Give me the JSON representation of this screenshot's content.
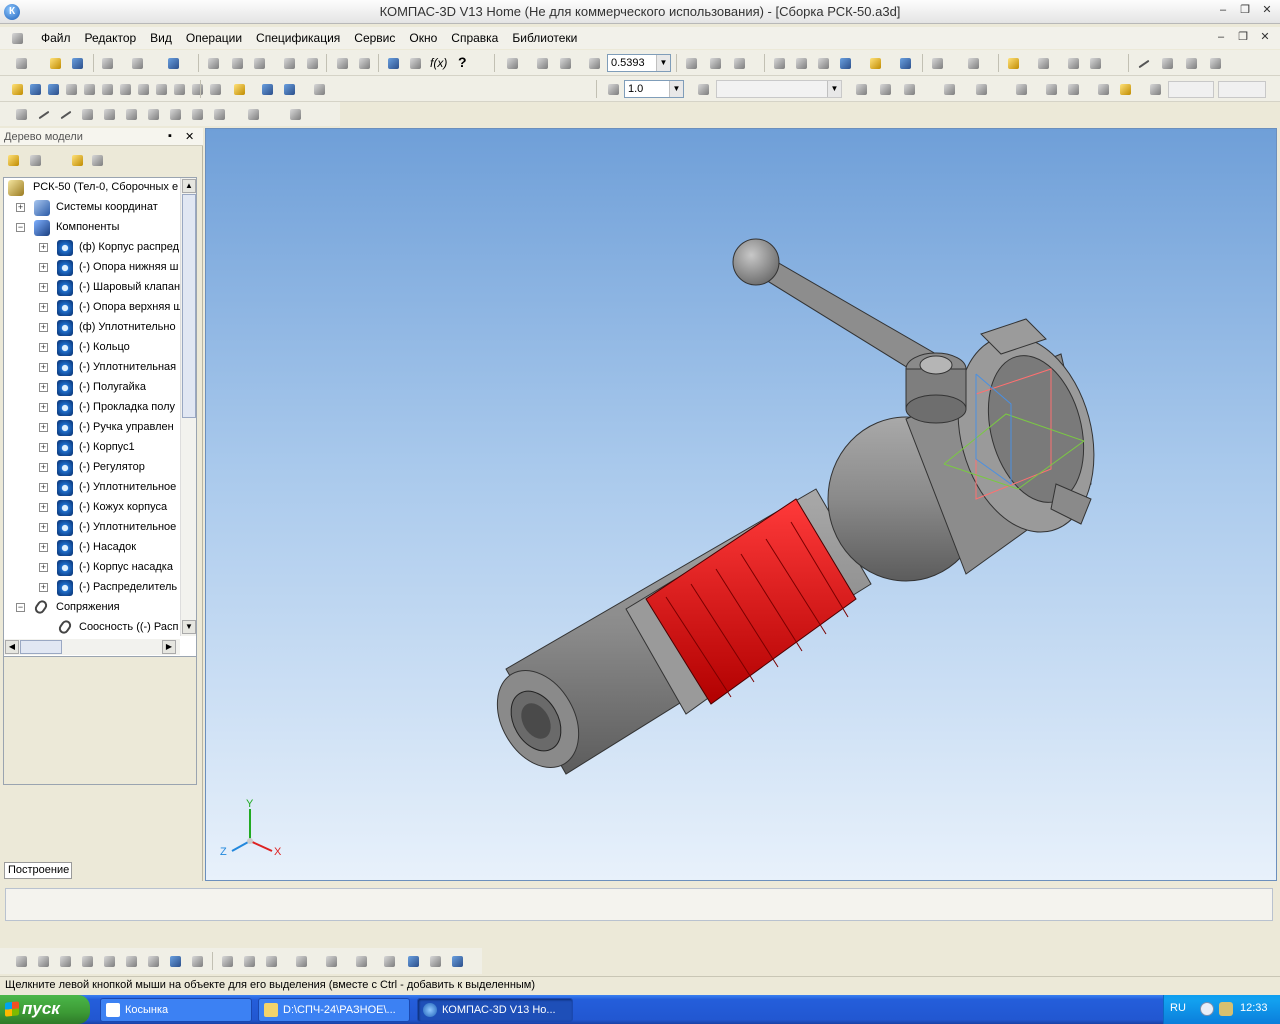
{
  "app": {
    "title": "КОМПАС-3D V13 Home (Не для коммерческого использования) - [Сборка РСК-50.a3d]",
    "icon_letter": "К",
    "accent": "#1f6fcc"
  },
  "window_controls": {
    "minimize": "‒",
    "maximize": "❐",
    "close": "✕"
  },
  "menu": {
    "items": [
      "Файл",
      "Редактор",
      "Вид",
      "Операции",
      "Спецификация",
      "Сервис",
      "Окно",
      "Справка",
      "Библиотеки"
    ]
  },
  "toolbar": {
    "zoom_value": "0.5393",
    "step_value": "1.0"
  },
  "panel": {
    "title": "Дерево модели",
    "pin": "▪",
    "close": "✕"
  },
  "tree": {
    "root": "РСК-50 (Тел-0, Сборочных е",
    "coord_systems": "Системы координат",
    "components_label": "Компоненты",
    "components": [
      "(ф) Корпус распред",
      "(-) Опора нижняя ш",
      "(-) Шаровый клапан",
      "(-) Опора верхняя ш",
      "(ф) Уплотнительно",
      "(-) Кольцо",
      "(-) Уплотнительная",
      "(-) Полугайка",
      "(-) Прокладка полу",
      "(-) Ручка управлен",
      "(-) Корпус1",
      "(-) Регулятор",
      "(-) Уплотнительное",
      "(-) Кожух корпуса",
      "(-) Уплотнительное",
      "(-) Насадок",
      "(-) Корпус насадка",
      "(-) Распределитель"
    ],
    "mates_label": "Сопряжения",
    "mates": [
      "Соосность ((-) Расп"
    ]
  },
  "axes": {
    "x": "X",
    "y": "Y",
    "z": "Z"
  },
  "bottom_tab": "Построение",
  "status": "Щелкните левой кнопкой мыши на объекте для его выделения (вместе с Ctrl - добавить к выделенным)",
  "taskbar": {
    "start": "пуск",
    "tasks": [
      "Косынка",
      "D:\\СПЧ-24\\РАЗНОЕ\\...",
      "КОМПАС-3D V13 Ho..."
    ],
    "lang": "RU",
    "time": "12:33"
  }
}
